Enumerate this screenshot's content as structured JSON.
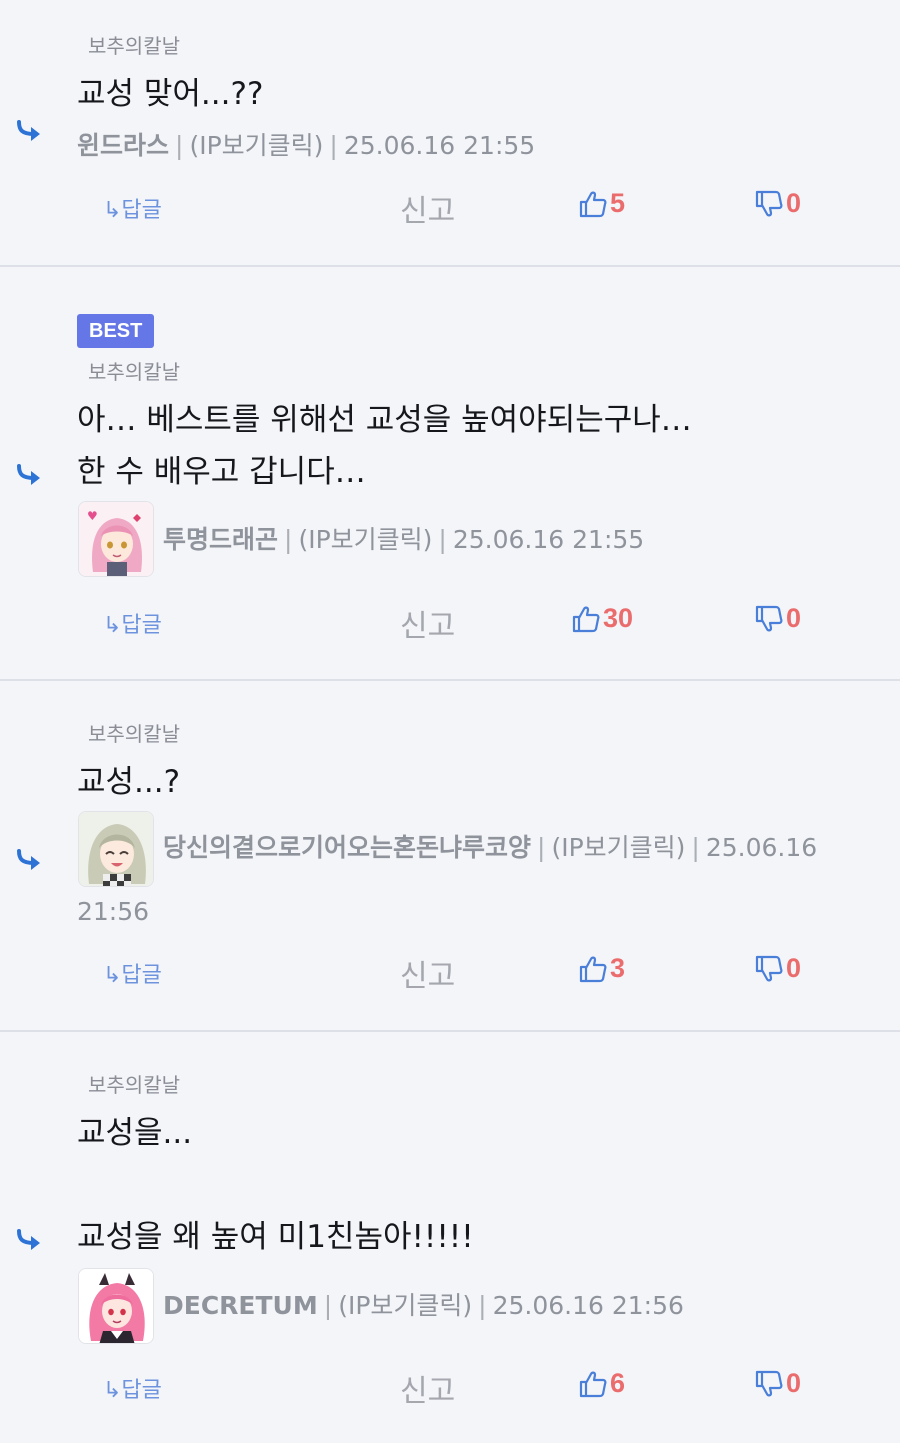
{
  "ui": {
    "reply_label": "↳답글",
    "report_label": "신고",
    "accent_color": "#6577e6",
    "link_color": "#6d93de",
    "count_color": "#ea6c6c"
  },
  "comments": [
    {
      "reply_to": "보추의칼날",
      "body": [
        "교성 맞어...??"
      ],
      "nick": "윈드라스",
      "ip_label": "(IP보기클릭)",
      "date": "25.06.16 21:55",
      "likes": "5",
      "dislikes": "0"
    },
    {
      "badge": "BEST",
      "reply_to": "보추의칼날",
      "body": [
        "아… 베스트를 위해선 교성을 높여야되는구나…",
        "한 수 배우고 갑니다…"
      ],
      "nick": "투명드래곤",
      "ip_label": "(IP보기클릭)",
      "date": "25.06.16 21:55",
      "likes": "30",
      "dislikes": "0"
    },
    {
      "reply_to": "보추의칼날",
      "body": [
        "교성...?"
      ],
      "nick": "당신의곁으로기어오는혼돈냐루코양",
      "ip_label": "(IP보기클릭)",
      "date_part1": "25.06.16",
      "date_part2": "21:56",
      "likes": "3",
      "dislikes": "0"
    },
    {
      "reply_to": "보추의칼날",
      "body": [
        "교성을...",
        "교성을 왜 높여 미1친놈아!!!!!"
      ],
      "nick": "DECRETUM",
      "ip_label": "(IP보기클릭)",
      "date": "25.06.16 21:56",
      "likes": "6",
      "dislikes": "0"
    }
  ]
}
